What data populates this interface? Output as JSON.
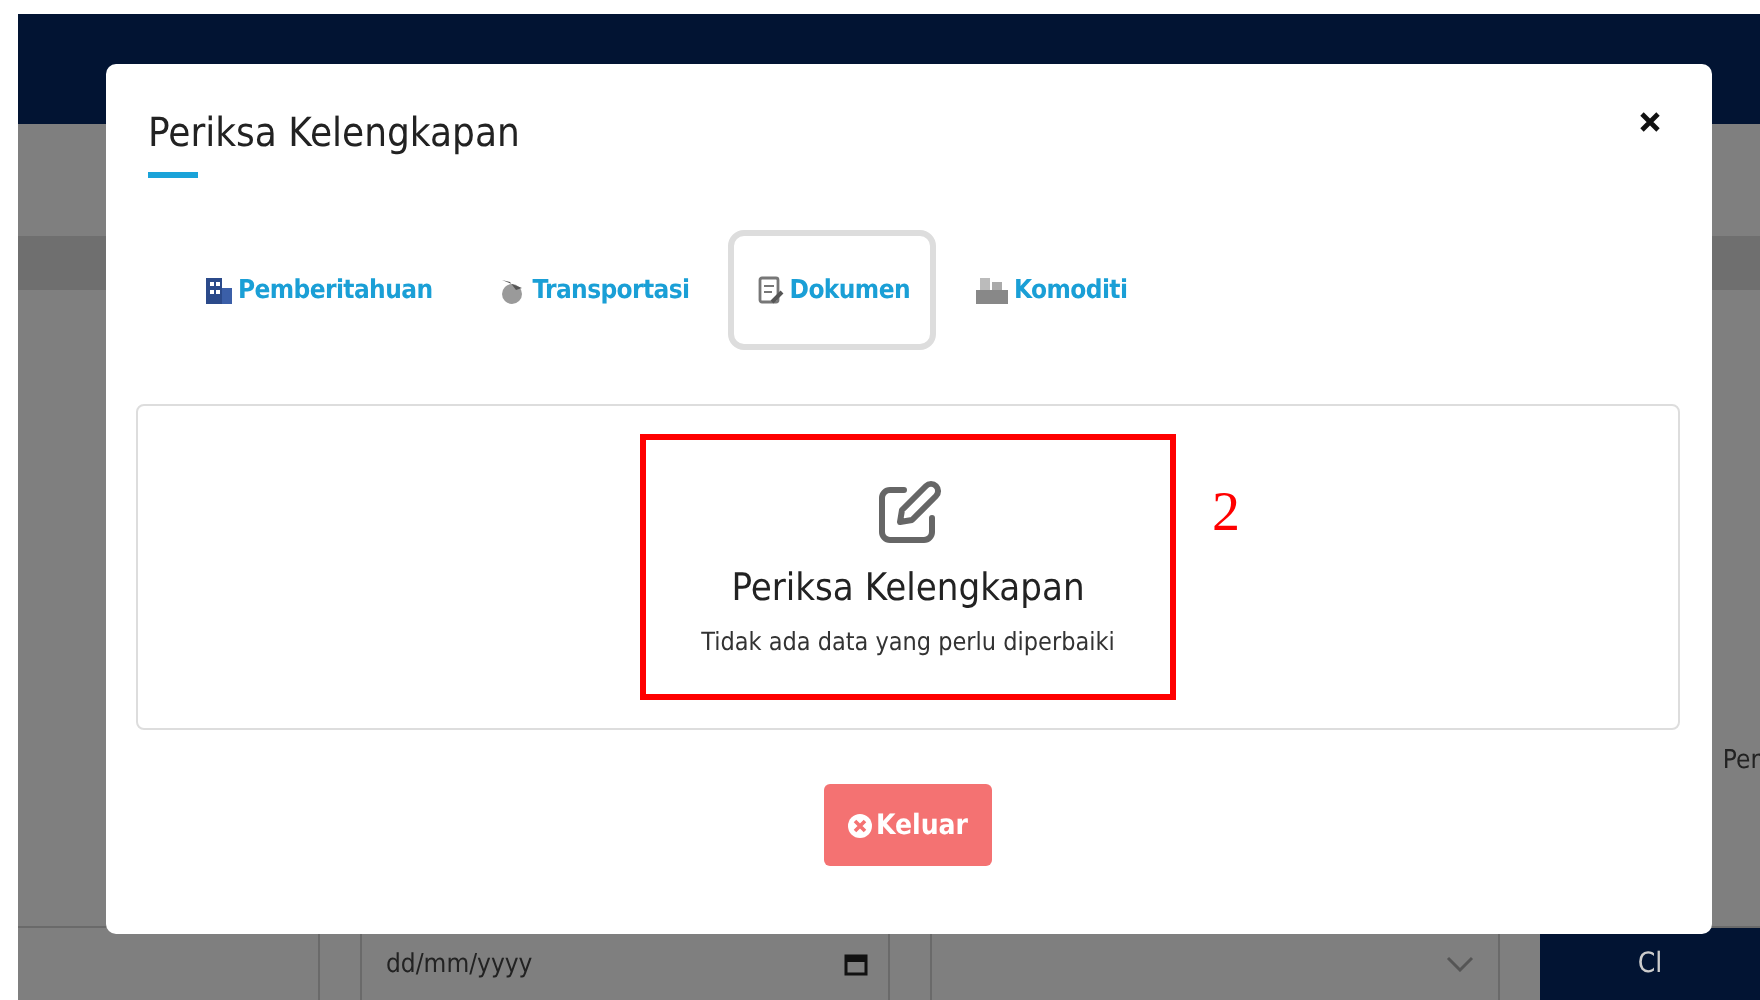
{
  "background": {
    "side_text": "Per",
    "date_field": {
      "placeholder": "dd/mm/yyyy"
    },
    "action_button": "Cl"
  },
  "modal": {
    "title": "Periksa Kelengkapan",
    "tabs": [
      {
        "label": "Pemberitahuan",
        "selected": false
      },
      {
        "label": "Transportasi",
        "selected": false
      },
      {
        "label": "Dokumen",
        "selected": true
      },
      {
        "label": "Komoditi",
        "selected": false
      }
    ],
    "panel": {
      "heading": "Periksa Kelengkapan",
      "message": "Tidak ada data yang perlu diperbaiki"
    },
    "annotation": "2",
    "exit_button": "Keluar"
  }
}
